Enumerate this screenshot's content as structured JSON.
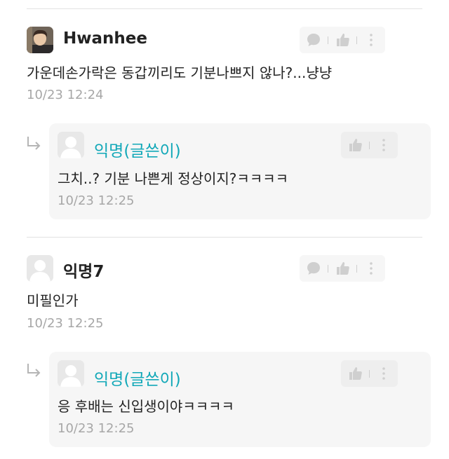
{
  "comments": [
    {
      "author": "Hwanhee",
      "text": "가운데손가락은 동갑끼리도 기분나쁘지 않나?...냥냥",
      "time": "10/23 12:24",
      "reply": {
        "author": "익명(글쓴이)",
        "text": "그치..? 기분 나쁜게 정상이지?ㅋㅋㅋㅋ",
        "time": "10/23 12:25"
      }
    },
    {
      "author": "익명7",
      "text": "미필인가",
      "time": "10/23 12:25",
      "reply": {
        "author": "익명(글쓴이)",
        "text": "응 후배는 신입생이야ㅋㅋㅋㅋ",
        "time": "10/23 12:25"
      }
    }
  ],
  "icons": {
    "comment": "speech-bubble-icon",
    "like": "thumbs-up-icon",
    "more": "vertical-dots-icon",
    "reply": "reply-arrow-icon",
    "default_avatar": "anonymous-avatar"
  },
  "colors": {
    "writer_name": "#12a8b8",
    "time": "#a7a7a7",
    "reply_bg": "#f6f6f6"
  }
}
